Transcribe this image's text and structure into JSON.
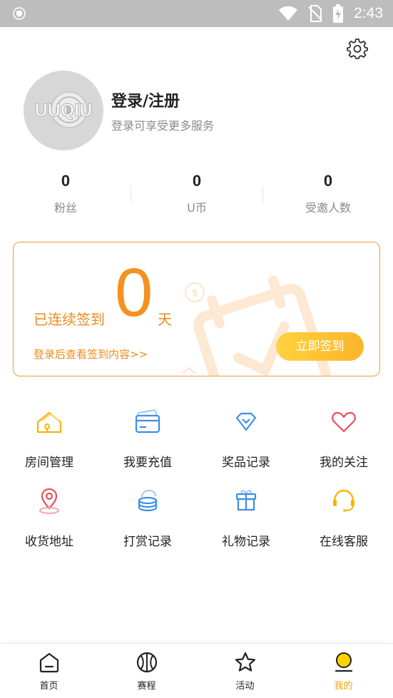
{
  "status_bar": {
    "time": "2:43"
  },
  "profile": {
    "avatar_text": "UUQIU",
    "title": "登录/注册",
    "subtitle": "登录可享受更多服务"
  },
  "stats": [
    {
      "value": "0",
      "label": "粉丝"
    },
    {
      "value": "0",
      "label": "U币"
    },
    {
      "value": "0",
      "label": "受邀人数"
    }
  ],
  "sign_in": {
    "prefix": "已连续签到",
    "days": "0",
    "suffix": "天",
    "link": "登录后查看签到内容>>",
    "button": "立即签到"
  },
  "menu": [
    {
      "label": "房间管理",
      "icon": "house-icon"
    },
    {
      "label": "我要充值",
      "icon": "card-icon"
    },
    {
      "label": "奖品记录",
      "icon": "diamond-icon"
    },
    {
      "label": "我的关注",
      "icon": "heart-icon"
    },
    {
      "label": "收货地址",
      "icon": "location-pin-icon"
    },
    {
      "label": "打赏记录",
      "icon": "coins-icon"
    },
    {
      "label": "礼物记录",
      "icon": "gift-icon"
    },
    {
      "label": "在线客服",
      "icon": "headset-icon"
    }
  ],
  "tabs": [
    {
      "label": "首页",
      "icon": "home-icon",
      "active": false
    },
    {
      "label": "赛程",
      "icon": "basketball-icon",
      "active": false
    },
    {
      "label": "活动",
      "icon": "star-icon",
      "active": false
    },
    {
      "label": "我的",
      "icon": "profile-icon",
      "active": true
    }
  ],
  "colors": {
    "accent_orange": "#f5911f",
    "button_yellow": "#fbb52a",
    "status_bar_bg": "#bdbdbd",
    "active_tab": "#f5a400"
  }
}
